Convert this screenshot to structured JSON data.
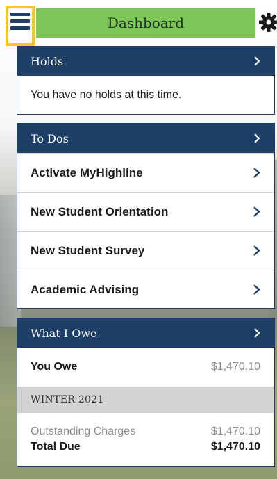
{
  "header": {
    "title": "Dashboard",
    "menu_icon": "hamburger-menu-icon",
    "settings_icon": "gear-icon"
  },
  "holds": {
    "title": "Holds",
    "message": "You have no holds at this time."
  },
  "todos": {
    "title": "To Dos",
    "items": [
      {
        "label": "Activate MyHighline"
      },
      {
        "label": "New Student Orientation"
      },
      {
        "label": "New Student Survey"
      },
      {
        "label": "Academic Advising"
      }
    ]
  },
  "owe": {
    "title": "What I Owe",
    "you_owe_label": "You Owe",
    "you_owe_amount": "$1,470.10",
    "term": "WINTER 2021",
    "outstanding_label": "Outstanding Charges",
    "outstanding_amount": "$1,470.10",
    "total_label": "Total Due",
    "total_amount": "$1,470.10"
  },
  "colors": {
    "navy": "#1e3f68",
    "title_green": "#7cc758",
    "highlight_yellow": "#f2c81e"
  }
}
